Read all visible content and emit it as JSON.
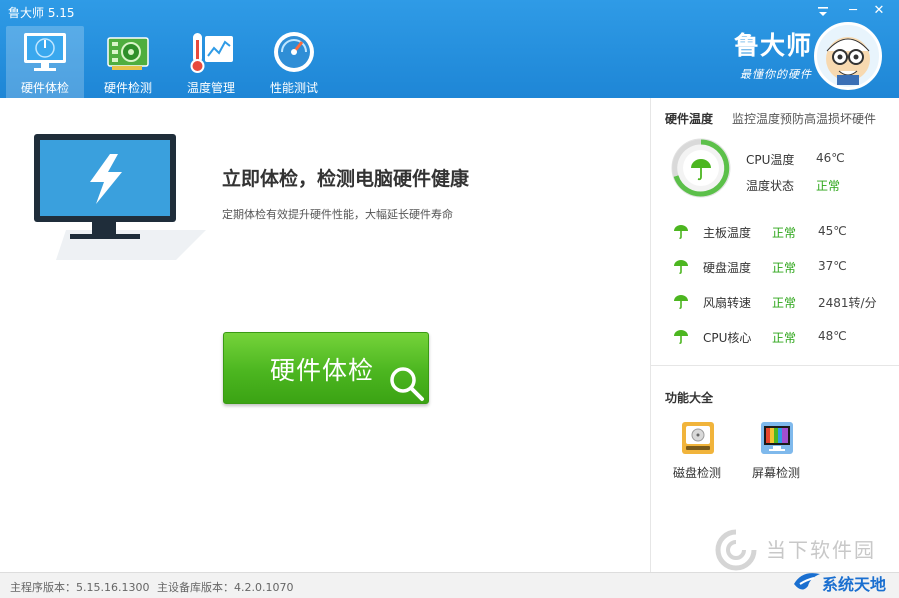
{
  "window": {
    "title": "鲁大师 5.15",
    "settings_icon": "menu-icon",
    "min_label": "─",
    "close_label": "✕"
  },
  "tabs": [
    {
      "label": "硬件体检",
      "icon": "monitor-icon",
      "active": true
    },
    {
      "label": "硬件检测",
      "icon": "circuit-board-icon",
      "active": false
    },
    {
      "label": "温度管理",
      "icon": "thermometer-icon",
      "active": false
    },
    {
      "label": "性能测试",
      "icon": "speedometer-icon",
      "active": false
    }
  ],
  "brand": {
    "title": "鲁大师",
    "slogan": "最懂你的硬件"
  },
  "main": {
    "title": "立即体检，检测电脑硬件健康",
    "subtitle": "定期体检有效提升硬件性能，大幅延长硬件寿命",
    "button_label": "硬件体检"
  },
  "hardware_temp": {
    "title": "硬件温度",
    "desc": "监控温度预防高温损坏硬件",
    "cpu": {
      "label": "CPU温度",
      "value": "46℃",
      "status_label": "温度状态",
      "status": "正常"
    },
    "items": [
      {
        "label": "主板温度",
        "status": "正常",
        "value": "45℃"
      },
      {
        "label": "硬盘温度",
        "status": "正常",
        "value": "37℃"
      },
      {
        "label": "风扇转速",
        "status": "正常",
        "value": "2481转/分"
      },
      {
        "label": "CPU核心",
        "status": "正常",
        "value": "48℃"
      }
    ]
  },
  "functions": {
    "title": "功能大全",
    "items": [
      {
        "label": "磁盘检测",
        "icon": "disk-check-icon"
      },
      {
        "label": "屏幕检测",
        "icon": "screen-check-icon"
      }
    ]
  },
  "footer": {
    "main_version": "主程序版本：5.15.16.1300",
    "db_version": "主设备库版本：4.2.0.1070"
  },
  "watermarks": {
    "site1": "当下软件园",
    "site2": "系统天地"
  },
  "colors": {
    "header": "#1e86d6",
    "ok": "#2da61a",
    "button": "#4cb620"
  }
}
